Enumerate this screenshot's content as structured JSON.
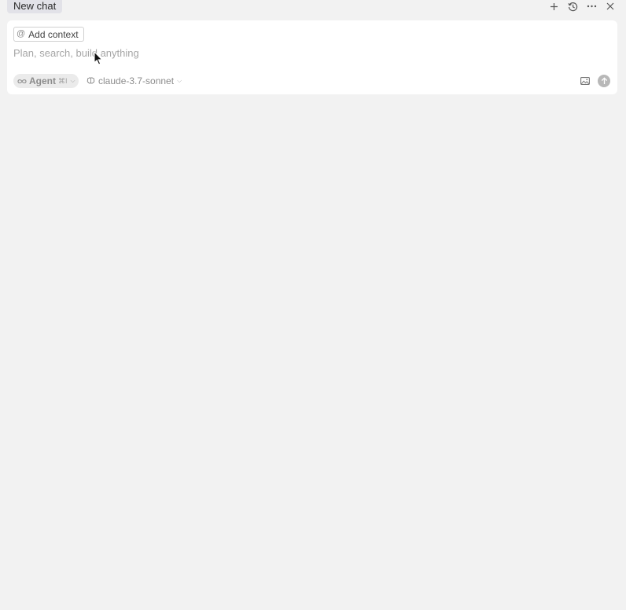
{
  "header": {
    "tab_label": "New chat",
    "actions": [
      {
        "name": "new-chat",
        "icon": "plus-icon"
      },
      {
        "name": "history",
        "icon": "history-icon"
      },
      {
        "name": "more",
        "icon": "more-horizontal-icon"
      },
      {
        "name": "close",
        "icon": "close-icon"
      }
    ]
  },
  "composer": {
    "add_context_label": "Add context",
    "add_context_icon": "at-sign-icon",
    "input_placeholder": "Plan, search, build anything",
    "input_value": "",
    "mode": {
      "label": "Agent",
      "shortcut": "⌘I",
      "icon": "infinity-icon"
    },
    "model": {
      "label": "claude-3.7-sonnet",
      "icon": "brain-icon"
    },
    "image_icon": "image-icon",
    "send_icon": "arrow-up-icon"
  },
  "colors": {
    "background": "#f2f2f2",
    "card": "#ffffff",
    "tab_bg": "#e2e2e8",
    "muted_text": "#8c8c8c",
    "send_bg": "#b8b8b8"
  }
}
